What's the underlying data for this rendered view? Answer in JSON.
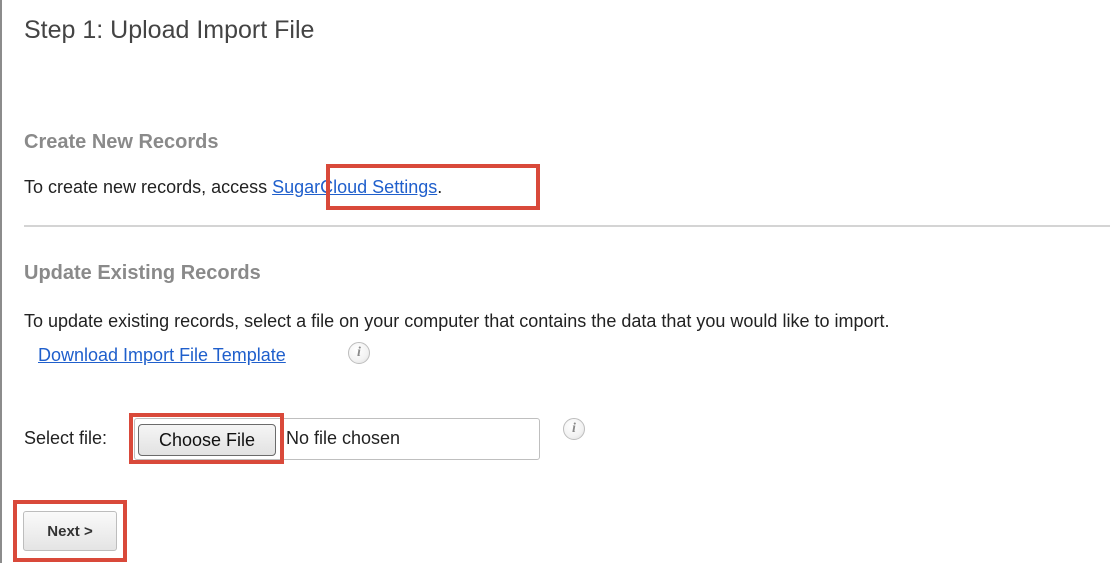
{
  "step": {
    "title": "Step 1: Upload Import File"
  },
  "create_section": {
    "heading": "Create New Records",
    "text_before_link": "To create new records, access ",
    "link_label": "SugarCloud Settings",
    "text_after_link": "."
  },
  "update_section": {
    "heading": "Update Existing Records",
    "description": "To update existing records, select a file on your computer that contains the data that you would like to import.",
    "template_link": "Download Import File Template",
    "info_icon": "info-icon"
  },
  "file_select": {
    "label": "Select file:",
    "button_label": "Choose File",
    "status": "No file chosen",
    "info_icon": "info-icon"
  },
  "actions": {
    "next_label": "Next >"
  },
  "colors": {
    "highlight": "#d9493a",
    "link": "#1f5fcc",
    "heading": "#8a8a8a"
  }
}
